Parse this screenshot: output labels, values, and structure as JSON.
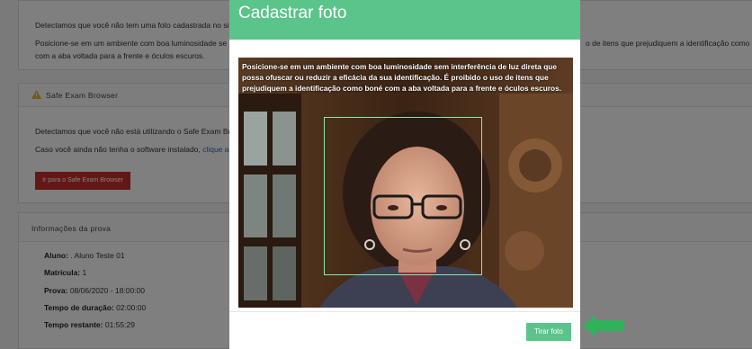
{
  "background": {
    "photo_panel": {
      "line1": "Detectamos que você não tem uma foto cadastrada no si",
      "line2_left": "Posicione-se em um ambiente com boa luminosidade se",
      "line2_right": "o de itens que prejudiquem a identificação como",
      "line3": "com a aba voltada para a frente e óculos escuros."
    },
    "seb_panel": {
      "title": "Safe Exam Browser",
      "line1": "Detectamos que você não está utilizando o Safe Exam Bro",
      "line2": "Caso você ainda não tenha o software instalado, ",
      "line2_link": "clique a",
      "button_label": "Ir para o Safe Exam Browser"
    },
    "info_panel": {
      "title": "Informações da prova",
      "rows": [
        {
          "label": "Aluno:",
          "value": " . Aluno Teste 01"
        },
        {
          "label": "Matrícula:",
          "value": " 1"
        },
        {
          "label": "Prova:",
          "value": " 08/06/2020 - 18:00:00"
        },
        {
          "label": "Tempo de duração:",
          "value": " 02:00:00"
        },
        {
          "label": "Tempo restante:",
          "value": " 01:55:29"
        }
      ]
    }
  },
  "modal": {
    "title": "Cadastrar foto",
    "camera_instructions": "Posicione-se em um ambiente com boa luminosidade sem interferência de luz direta que possa ofuscar ou reduzir a eficácia da sua identificação. É proibido o uso de itens que prejudiquem a identificação como boné com a aba voltada para a frente e óculos escuros.",
    "button_label": "Tirar foto"
  },
  "icons": {
    "warning": "warning-icon",
    "arrow": "arrow-left-icon"
  },
  "colors": {
    "accent": "#5bc48b",
    "danger": "#c9302c",
    "arrow": "#2fb35a"
  }
}
